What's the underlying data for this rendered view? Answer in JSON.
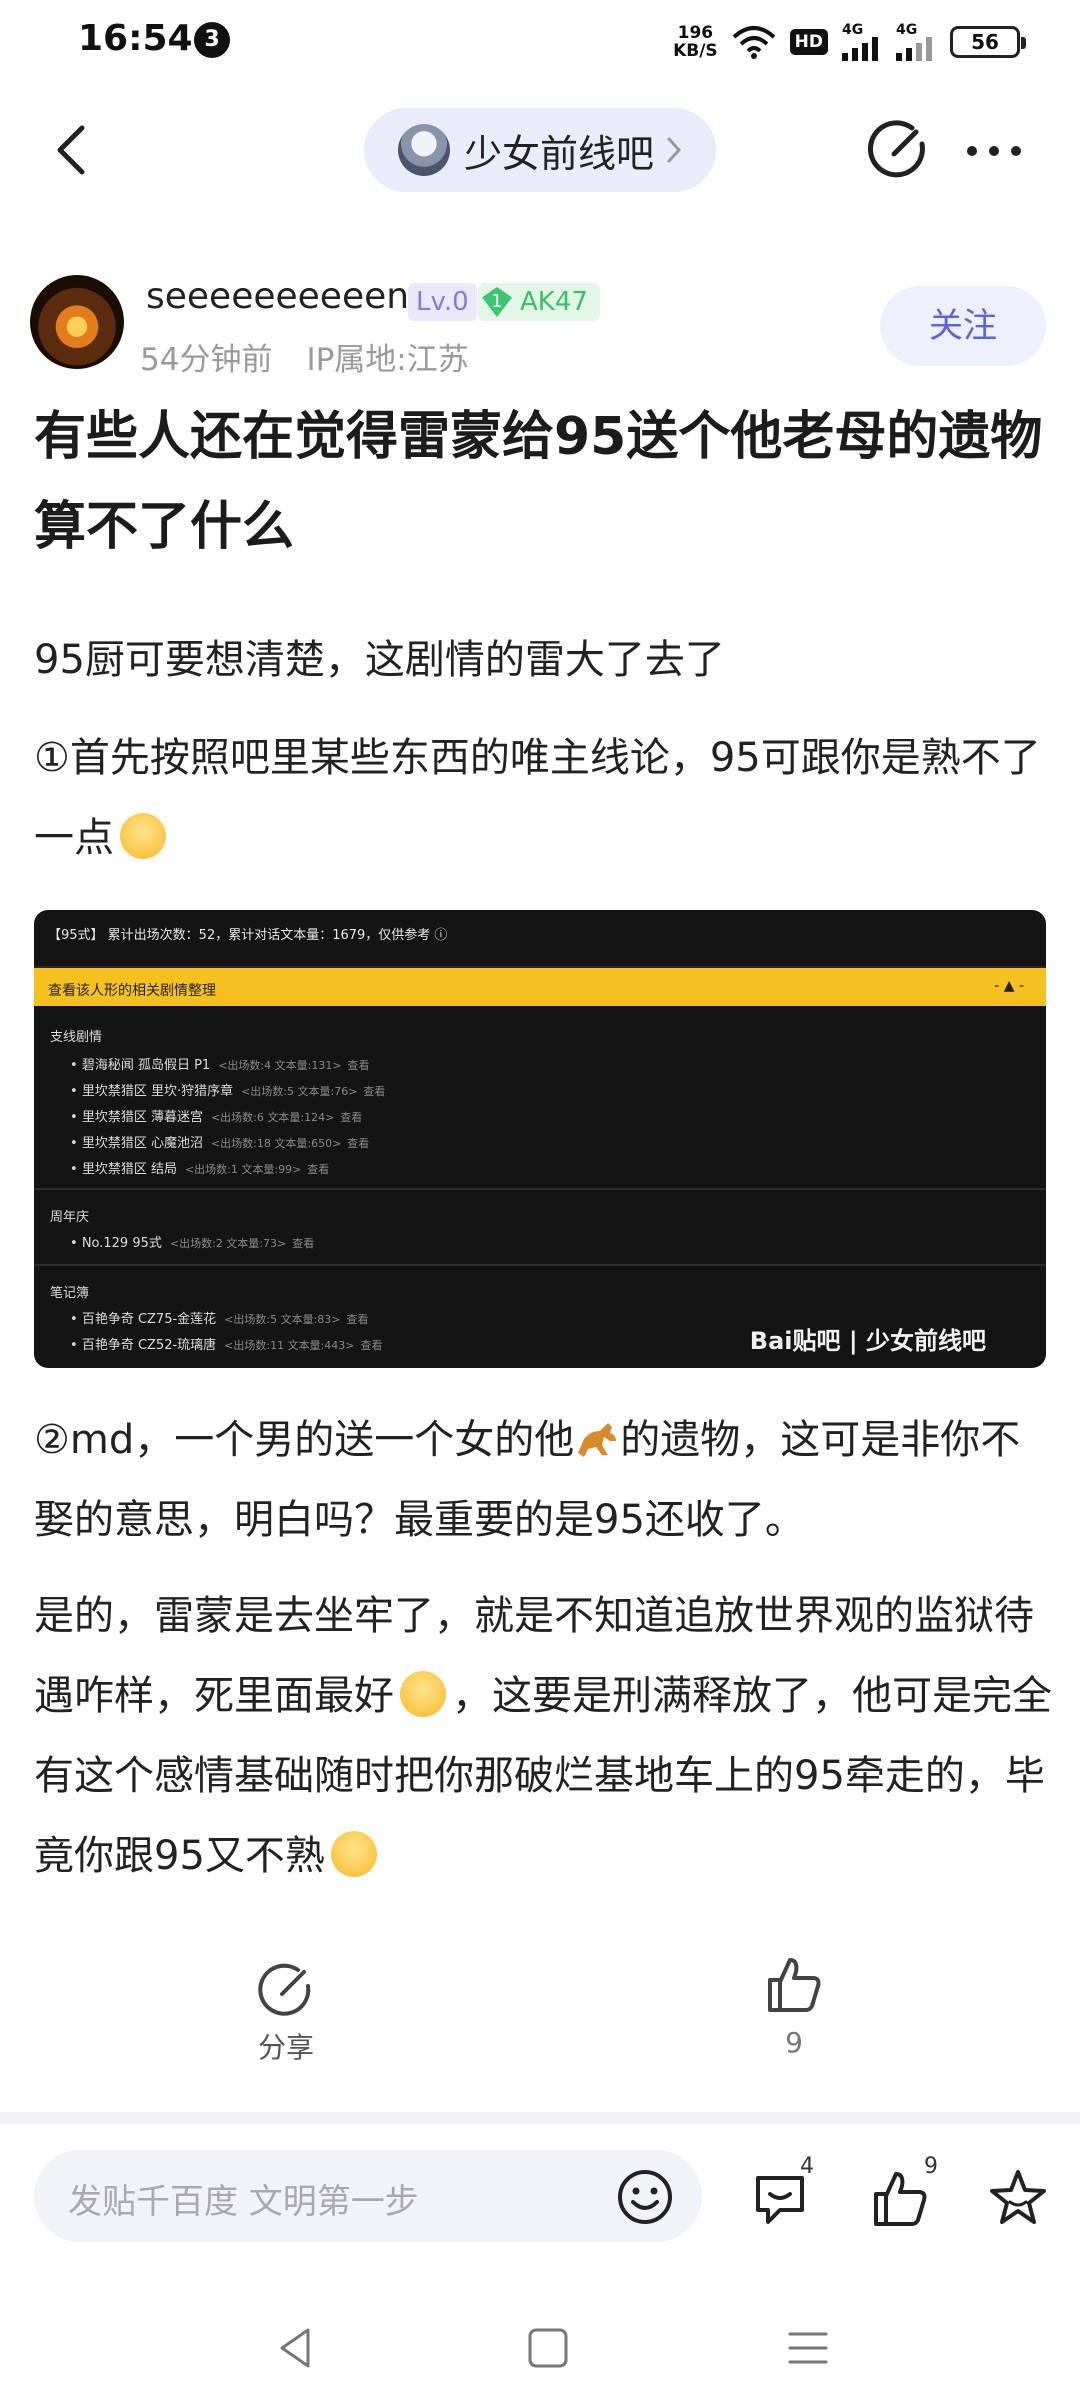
{
  "status_bar": {
    "time": "16:54",
    "notification_count": "3",
    "net_speed_value": "196",
    "net_speed_unit": "KB/S",
    "hd_label": "HD",
    "signal1_label": "4G",
    "signal2_label": "4G",
    "battery": "56"
  },
  "nav": {
    "forum_name": "少女前线吧"
  },
  "author": {
    "name": "seeeeeeeeeen",
    "level": "Lv.0",
    "title_level": "1",
    "title": "AK47",
    "time_ago": "54分钟前",
    "ip_location": "IP属地:江苏",
    "follow_label": "关注"
  },
  "post": {
    "title": "有些人还在觉得雷蒙给95送个他老母的遗物算不了什么",
    "paragraph1": "95厨可要想清楚，这剧情的雷大了去了",
    "paragraph2": "①首先按照吧里某些东西的唯主线论，95可跟你是熟不了一点",
    "paragraph3_a": "②md，一个男的送一个女的他",
    "paragraph3_b": "的遗物，这可是非你不娶的意思，明白吗？最重要的是95还收了。",
    "paragraph4_a": "是的，雷蒙是去坐牢了，就是不知道追放世界观的监狱待遇咋样，死里面最好",
    "paragraph4_b": "，这要是刑满释放了，他可是完全有这个感情基础随时把你那破烂基地车上的95牵走的，毕竟你跟95又不熟"
  },
  "image": {
    "header": "【95式】 累计出场次数：52，累计对话文本量：1679，仅供参考 ⓘ",
    "bar_title": "查看该人形的相关剧情整理",
    "bar_control": "- ▲ -",
    "sections": [
      {
        "name": "支线剧情",
        "rows": [
          {
            "title": "碧海秘闻 孤岛假日 P1",
            "sub": "<出场数:4 文本量:131>",
            "view": "查看"
          },
          {
            "title": "里坎禁猎区 里坎·狩猎序章",
            "sub": "<出场数:5 文本量:76>",
            "view": "查看"
          },
          {
            "title": "里坎禁猎区 薄暮迷宫",
            "sub": "<出场数:6 文本量:124>",
            "view": "查看"
          },
          {
            "title": "里坎禁猎区 心魔池沼",
            "sub": "<出场数:18 文本量:650>",
            "view": "查看"
          },
          {
            "title": "里坎禁猎区 结局",
            "sub": "<出场数:1 文本量:99>",
            "view": "查看"
          }
        ]
      },
      {
        "name": "周年庆",
        "rows": [
          {
            "title": "No.129 95式",
            "sub": "<出场数:2 文本量:73>",
            "view": "查看"
          }
        ]
      },
      {
        "name": "笔记簿",
        "rows": [
          {
            "title": "百艳争奇 CZ75-金莲花",
            "sub": "<出场数:5 文本量:83>",
            "view": "查看"
          },
          {
            "title": "百艳争奇 CZ52-琉璃唐",
            "sub": "<出场数:11 文本量:443>",
            "view": "查看"
          }
        ]
      }
    ],
    "watermark": "Bai贴吧 | 少女前线吧"
  },
  "actions": {
    "share_label": "分享",
    "like_count": "9"
  },
  "bottom_bar": {
    "reply_placeholder": "发贴千百度 文明第一步",
    "comment_count": "4",
    "like_count": "9"
  },
  "icons": {
    "back": "back-arrow-icon",
    "forum_chevron": "chevron-right-icon",
    "edit": "edit-icon",
    "more": "more-dots-icon",
    "share": "share-icon",
    "like": "thumbs-up-icon",
    "emoji": "smiley-icon",
    "comment": "comment-icon",
    "star": "star-icon",
    "horse": "horse-emoji-icon"
  },
  "colors": {
    "accent": "#5b64d8",
    "image_bar": "#f5c020",
    "badge_green": "#3cbf6b",
    "level_purple": "#8b7bd1"
  }
}
